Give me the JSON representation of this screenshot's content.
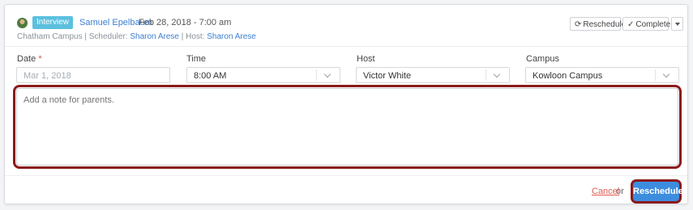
{
  "header": {
    "badge": "Interview",
    "student": "Samuel Epelbaum",
    "datetime": "Feb 28, 2018 - 7:00 am",
    "campus": "Chatham Campus",
    "scheduler_label": "Scheduler:",
    "scheduler": "Sharon Arese",
    "host_label": "Host:",
    "host": "Sharon Arese",
    "separator": "|"
  },
  "actions": {
    "reschedule": "Reschedule",
    "complete": "Complete"
  },
  "form": {
    "date": {
      "label": "Date",
      "required": "*",
      "placeholder": "Mar 1, 2018"
    },
    "time": {
      "label": "Time",
      "value": "8:00 AM"
    },
    "host": {
      "label": "Host",
      "value": "Victor White"
    },
    "campus": {
      "label": "Campus",
      "value": "Kowloon Campus"
    },
    "note": {
      "placeholder": "Add a note for parents."
    }
  },
  "footer": {
    "cancel": "Cancel",
    "or": "or",
    "submit": "Reschedule"
  },
  "colors": {
    "accent": "#3d8ddf",
    "badge": "#5bc0de",
    "link": "#3b7fd1",
    "highlight": "#8b1a1a",
    "cancel": "#e05b4f"
  },
  "icons": [
    "avatar",
    "refresh-icon",
    "check-icon",
    "caret-down-icon",
    "chevron-down-icon"
  ]
}
